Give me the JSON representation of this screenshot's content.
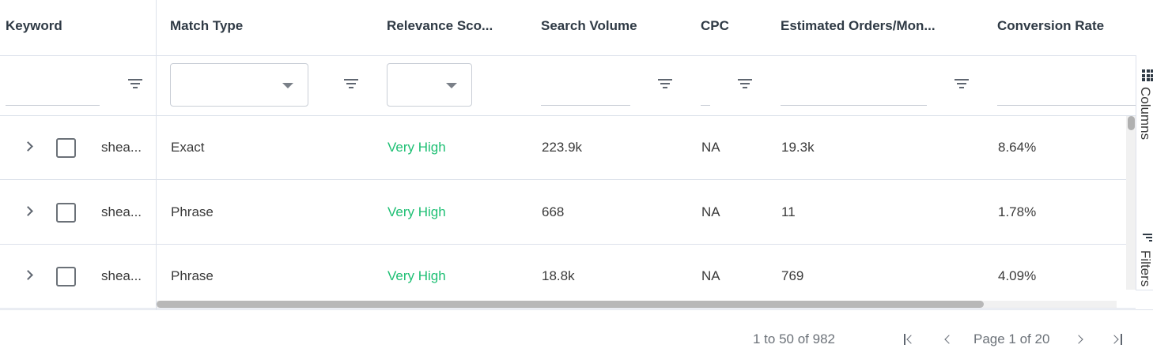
{
  "columns": {
    "keyword": "Keyword",
    "match_type": "Match Type",
    "relevance": "Relevance Sco...",
    "search_volume": "Search Volume",
    "cpc": "CPC",
    "est_orders": "Estimated Orders/Mon...",
    "conversion": "Conversion Rate"
  },
  "filters": {
    "keyword": "",
    "match_type": "",
    "relevance": "",
    "search_volume": "",
    "cpc": "",
    "est_orders": "",
    "conversion": ""
  },
  "rows": [
    {
      "keyword": "shea...",
      "match_type": "Exact",
      "relevance": "Very High",
      "search_volume": "223.9k",
      "cpc": "NA",
      "est_orders": "19.3k",
      "conversion": "8.64%"
    },
    {
      "keyword": "shea...",
      "match_type": "Phrase",
      "relevance": "Very High",
      "search_volume": "668",
      "cpc": "NA",
      "est_orders": "11",
      "conversion": "1.78%"
    },
    {
      "keyword": "shea...",
      "match_type": "Phrase",
      "relevance": "Very High",
      "search_volume": "18.8k",
      "cpc": "NA",
      "est_orders": "769",
      "conversion": "4.09%"
    }
  ],
  "sidebar": {
    "columns_label": "Columns",
    "filters_label": "Filters"
  },
  "paging": {
    "summary": "1 to 50 of 982",
    "page_text": "Page 1 of 20"
  },
  "colors": {
    "relevance_very_high": "#1dbf73",
    "border": "#dde2eb"
  },
  "icons": {
    "filter": "filter-funnel-icon",
    "expand": "chevron-right-icon",
    "columns": "columns-grid-icon",
    "first_page": "first-page-icon",
    "prev_page": "previous-page-icon",
    "next_page": "next-page-icon",
    "last_page": "last-page-icon"
  }
}
